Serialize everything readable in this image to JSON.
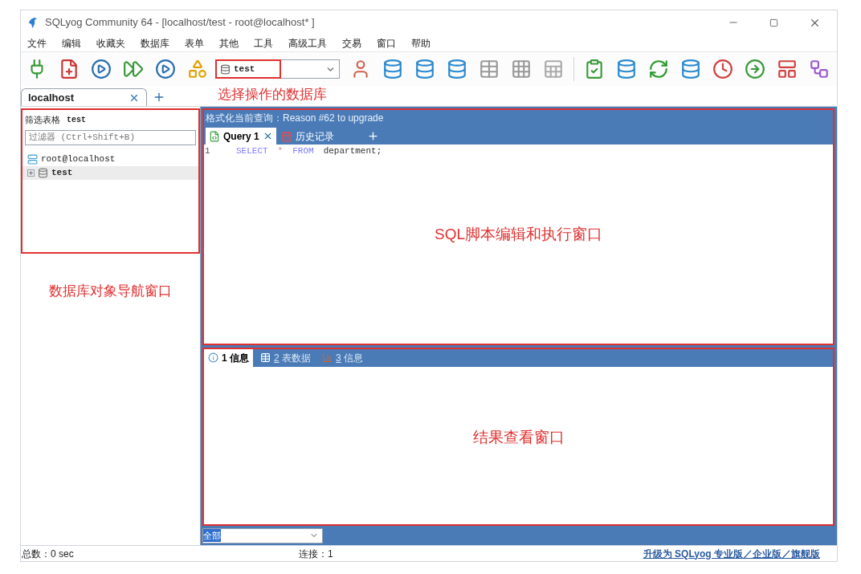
{
  "window": {
    "title": "SQLyog Community 64 - [localhost/test - root@localhost* ]"
  },
  "menu": [
    "文件",
    "编辑",
    "收藏夹",
    "数据库",
    "表单",
    "其他",
    "工具",
    "高级工具",
    "交易",
    "窗口",
    "帮助"
  ],
  "database_select": {
    "value": "test"
  },
  "annotations": {
    "database_select": "选择操作的数据库",
    "navigator": "数据库对象导航窗口",
    "editor": "SQL脚本编辑和执行窗口",
    "results": "结果查看窗口"
  },
  "connection_tabs": [
    {
      "label": "localhost",
      "selected": true
    }
  ],
  "navigator": {
    "filter_label": "筛选表格",
    "filter_database": "test",
    "filter_placeholder": "过滤器 (Ctrl+Shift+B)",
    "tree": [
      {
        "label": "root@localhost",
        "kind": "server",
        "selected": false,
        "children": [
          {
            "label": "test",
            "kind": "database",
            "selected": true,
            "expanded": false
          }
        ]
      }
    ]
  },
  "editor": {
    "header": "格式化当前查询：Reason #62 to upgrade",
    "tabs": [
      {
        "label": "Query 1",
        "kind": "query",
        "selected": true
      },
      {
        "label": "历史记录",
        "kind": "history",
        "selected": false
      }
    ],
    "lines": [
      {
        "number": "1",
        "tokens": [
          {
            "text": "SELECT",
            "kind": "keyword"
          },
          {
            "text": "*",
            "kind": "operator"
          },
          {
            "text": "FROM",
            "kind": "keyword"
          },
          {
            "text": "department;",
            "kind": "identifier"
          }
        ]
      }
    ]
  },
  "results": {
    "tabs": [
      {
        "number": "1",
        "label": "信息",
        "kind": "info",
        "selected": true
      },
      {
        "number": "2",
        "label": "表数据",
        "kind": "table",
        "selected": false
      },
      {
        "number": "3",
        "label": "信息",
        "kind": "chart",
        "selected": false
      }
    ],
    "filter": "全部"
  },
  "status_bar": {
    "time": "总数：0 sec",
    "connections": "连接：1",
    "upgrade_link": "升级为 SQLyog 专业版／企业版／旗舰版"
  }
}
